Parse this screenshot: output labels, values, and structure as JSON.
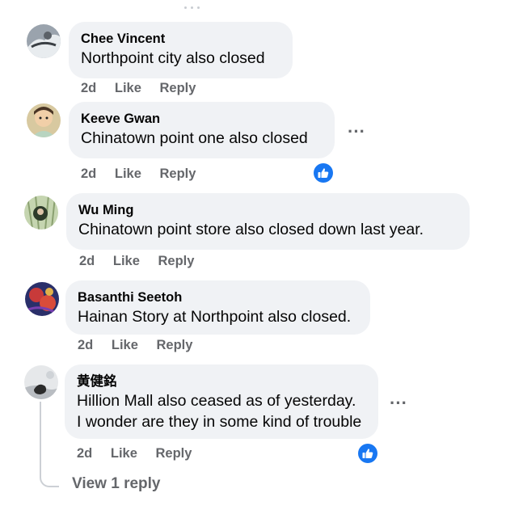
{
  "comments": [
    {
      "author": "Chee Vincent",
      "text": "Northpoint city also closed",
      "time": "2d",
      "like": "Like",
      "reply": "Reply"
    },
    {
      "author": "Keeve Gwan",
      "text": "Chinatown point one also closed",
      "time": "2d",
      "like": "Like",
      "reply": "Reply",
      "more": "···"
    },
    {
      "author": "Wu Ming",
      "text": "Chinatown point store also closed down last year.",
      "time": "2d",
      "like": "Like",
      "reply": "Reply"
    },
    {
      "author": "Basanthi Seetoh",
      "text": "Hainan Story at Northpoint also closed.",
      "time": "2d",
      "like": "Like",
      "reply": "Reply"
    },
    {
      "author": "黄健銘",
      "text_line1": "Hillion Mall also ceased as of yesterday.",
      "text_line2": "I wonder are they in some kind of trouble",
      "time": "2d",
      "like": "Like",
      "reply": "Reply",
      "more": "···"
    }
  ],
  "view_replies": "View 1 reply",
  "icons": {
    "like_reaction": "thumbs-up-icon",
    "more": "more-options-icon"
  },
  "colors": {
    "bubble": "#f0f2f5",
    "secondary_text": "#65676b",
    "like_blue": "#1877f2"
  }
}
